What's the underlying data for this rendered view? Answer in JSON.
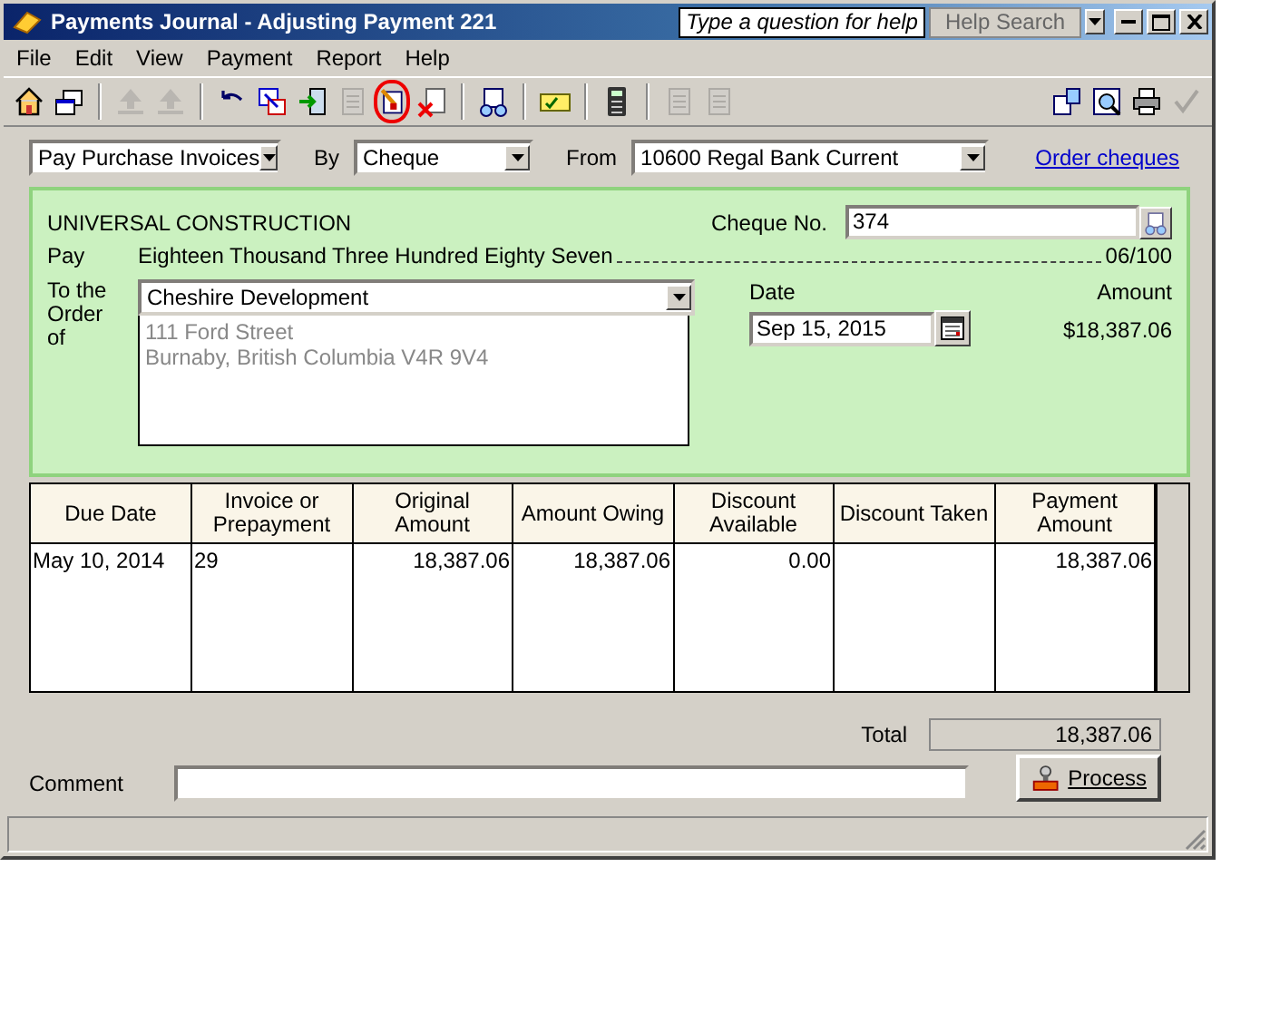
{
  "window": {
    "title": "Payments Journal - Adjusting Payment 221",
    "help_placeholder": "Type a question for help",
    "help_search": "Help Search"
  },
  "menu": [
    "File",
    "Edit",
    "View",
    "Payment",
    "Report",
    "Help"
  ],
  "toolbar_left": [
    [
      {
        "disabled": false,
        "circled": false
      },
      {
        "disabled": false,
        "circled": false
      }
    ],
    [
      {
        "disabled": true,
        "circled": false
      },
      {
        "disabled": true,
        "circled": false
      }
    ],
    [
      {
        "disabled": false,
        "circled": false
      },
      {
        "disabled": false,
        "circled": false
      },
      {
        "disabled": false,
        "circled": false
      },
      {
        "disabled": true,
        "circled": false
      },
      {
        "disabled": false,
        "circled": true
      },
      {
        "disabled": false,
        "circled": false
      }
    ],
    [
      {
        "disabled": false,
        "circled": false
      }
    ],
    [
      {
        "disabled": false,
        "circled": false
      }
    ],
    [
      {
        "disabled": false,
        "circled": false
      }
    ],
    [
      {
        "disabled": true,
        "circled": false
      },
      {
        "disabled": true,
        "circled": false
      }
    ]
  ],
  "toolbar_right": [
    {
      "disabled": false
    },
    {
      "disabled": false
    },
    {
      "disabled": false
    },
    {
      "disabled": true
    }
  ],
  "options": {
    "transaction": "Pay Purchase Invoices",
    "by_label": "By",
    "by": "Cheque",
    "from_label": "From",
    "from": "10600 Regal Bank Current",
    "order_link": "Order cheques"
  },
  "cheque": {
    "company": "UNIVERSAL CONSTRUCTION",
    "cheque_no_label": "Cheque No.",
    "cheque_no": "374",
    "pay_label": "Pay",
    "amount_words": "Eighteen Thousand Three Hundred Eighty Seven",
    "cents": "06/100",
    "order_label": "To the Order of",
    "payee": "Cheshire Development",
    "address": [
      "111 Ford Street",
      "Burnaby, British Columbia V4R 9V4"
    ],
    "date_label": "Date",
    "date": "Sep 15, 2015",
    "amount_label": "Amount",
    "amount": "$18,387.06"
  },
  "table": {
    "columns": [
      "Due Date",
      "Invoice or Prepayment",
      "Original Amount",
      "Amount Owing",
      "Discount Available",
      "Discount Taken",
      "Payment Amount"
    ],
    "rows": [
      [
        "May 10, 2014",
        "29",
        "18,387.06",
        "18,387.06",
        "0.00",
        "",
        "18,387.06"
      ]
    ]
  },
  "total_label": "Total",
  "total": "18,387.06",
  "comment_label": "Comment",
  "process_button": "Process"
}
